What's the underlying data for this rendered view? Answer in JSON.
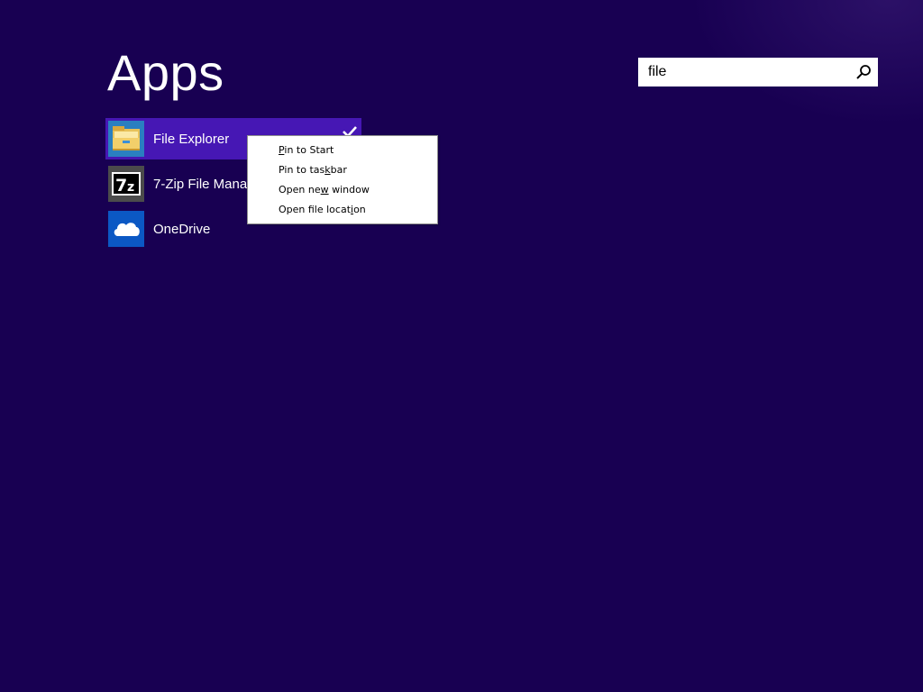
{
  "page": {
    "title": "Apps",
    "background_color": "#180052",
    "selection_color": "#4617b4"
  },
  "search": {
    "value": "file",
    "icon": "search-icon"
  },
  "apps": [
    {
      "label": "File Explorer",
      "icon": "file-explorer-icon",
      "selected": true,
      "tile_color": "#2a7fc0"
    },
    {
      "label": "7-Zip File Manager",
      "icon": "7zip-icon",
      "selected": false,
      "tile_color": "#4b4b4b"
    },
    {
      "label": "OneDrive",
      "icon": "onedrive-icon",
      "selected": false,
      "tile_color": "#0b58c4"
    }
  ],
  "context_menu": {
    "items": [
      {
        "label": "Pin to Start",
        "pre": "",
        "key": "P",
        "post": "in to Start"
      },
      {
        "label": "Pin to taskbar",
        "pre": "Pin to tas",
        "key": "k",
        "post": "bar"
      },
      {
        "label": "Open new window",
        "pre": "Open ne",
        "key": "w",
        "post": " window"
      },
      {
        "label": "Open file location",
        "pre": "Open file locat",
        "key": "i",
        "post": "on"
      }
    ]
  }
}
